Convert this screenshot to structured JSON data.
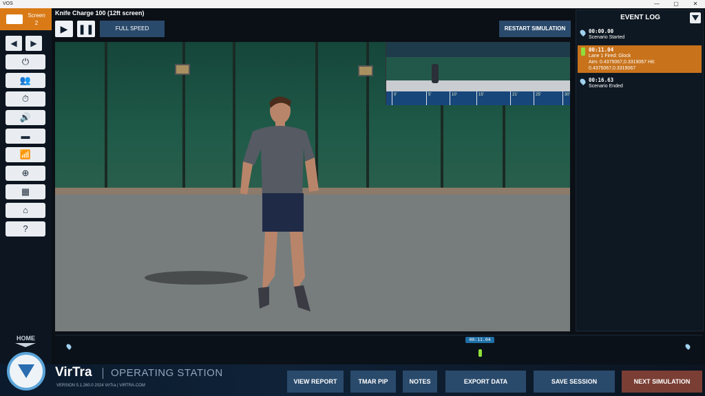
{
  "window": {
    "app_title": "VOS",
    "controls": [
      "—",
      "▢",
      "✕"
    ]
  },
  "sidebar": {
    "screen_label": "Screen",
    "screen_number": "2",
    "prev_icon": "◀",
    "next_icon": "▶",
    "tools": [
      {
        "icon": "power-icon",
        "glyph": "⏻"
      },
      {
        "icon": "users-icon",
        "glyph": "👥"
      },
      {
        "icon": "timer-icon",
        "glyph": "⏱"
      },
      {
        "icon": "volume-icon",
        "glyph": "🔊"
      },
      {
        "icon": "flashlight-icon",
        "glyph": "▬"
      },
      {
        "icon": "wifi-icon",
        "glyph": "📶"
      },
      {
        "icon": "target-icon",
        "glyph": "⊕"
      },
      {
        "icon": "layout-icon",
        "glyph": "▦"
      },
      {
        "icon": "presentation-icon",
        "glyph": "⌂"
      },
      {
        "icon": "help-icon",
        "glyph": "?"
      }
    ],
    "home_label": "HOME"
  },
  "toolbar": {
    "scenario_title": "Knife Charge 100 (12ft screen)",
    "play_glyph": "▶",
    "pause_glyph": "❚❚",
    "speed_label": "FULL SPEED",
    "restart_label": "RESTART SIMULATION"
  },
  "pip": {
    "distances": [
      "0'",
      "5'",
      "10'",
      "15'",
      "21'",
      "25'",
      "30'"
    ]
  },
  "event_log": {
    "title": "EVENT LOG",
    "events": [
      {
        "time": "00:00.00",
        "lines": [
          "Scenario Started"
        ]
      },
      {
        "time": "00:11.04",
        "lines": [
          "Lane 1 Fired: Glock",
          "Aim: 0.4375067,0.3319067 Hit:",
          "0.4375067,0.3319067"
        ]
      },
      {
        "time": "00:16.63",
        "lines": [
          "Scenario Ended"
        ]
      }
    ]
  },
  "timeline": {
    "marker_time": "00:11.04"
  },
  "branding": {
    "name": "VirTra",
    "product": "OPERATING STATION",
    "version": "VERSION 5.1.260.0   2024 VirTra | VIRTRA.COM"
  },
  "actions": {
    "view_report": "VIEW REPORT",
    "tmar_pip": "TMAR PIP",
    "notes": "NOTES",
    "export_data": "EXPORT DATA",
    "save_session": "SAVE SESSION",
    "next_simulation": "NEXT SIMULATION"
  },
  "colors": {
    "accent": "#d97a16",
    "button": "#2a4a6b",
    "next": "#7a3e34",
    "selected_event": "#c8731c"
  }
}
